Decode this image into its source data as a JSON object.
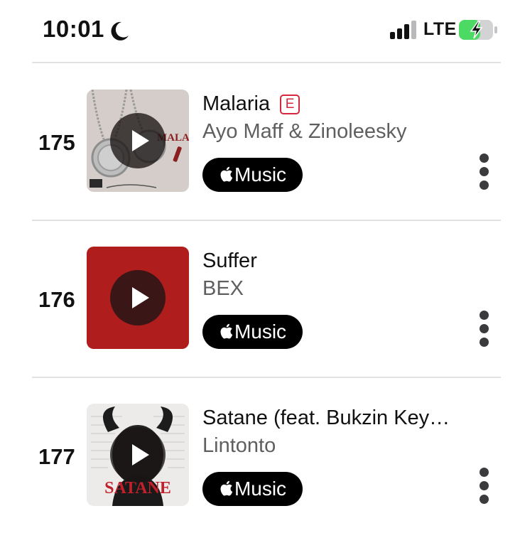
{
  "status_bar": {
    "time": "10:01",
    "network": "LTE",
    "icons": [
      "moon-icon",
      "signal-icon",
      "battery-charging-icon"
    ]
  },
  "colors": {
    "explicit_badge": "#d3283d",
    "music_button": "#000000",
    "battery_fill": "#4cd964",
    "divider": "#e1e1e4"
  },
  "list": {
    "items": [
      {
        "rank": "175",
        "title": "Malaria",
        "explicit": true,
        "explicit_label": "E",
        "artist": "Ayo Maff & Zinoleesky",
        "service_label": "Music",
        "cover_text": "MALARIA"
      },
      {
        "rank": "176",
        "title": "Suffer",
        "explicit": false,
        "artist": "BEX",
        "service_label": "Music"
      },
      {
        "rank": "177",
        "title": "Satane (feat. Bukzin Key…",
        "explicit": false,
        "artist": "Lintonto",
        "service_label": "Music",
        "cover_text": "SATANE"
      }
    ]
  }
}
